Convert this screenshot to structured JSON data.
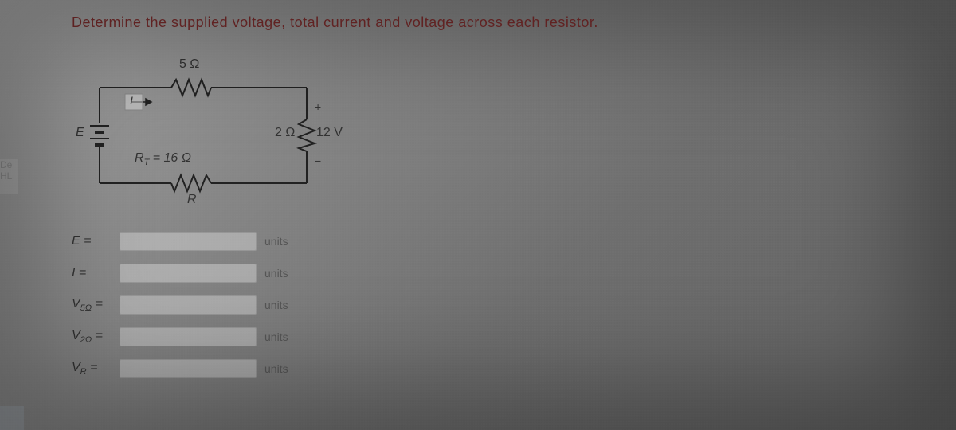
{
  "prompt": "Determine the supplied voltage, total current and voltage across each resistor.",
  "circuit": {
    "source_label": "E",
    "current_label": "I",
    "r1_label": "5 Ω",
    "r2_value": "2 Ω",
    "r2_volt": "12 V",
    "r2_plus": "+",
    "r2_minus": "−",
    "rt_label": "R_T = 16 Ω",
    "r_bottom_label": "R"
  },
  "answers": [
    {
      "label": "E =",
      "units": "units"
    },
    {
      "label": "I =",
      "units": "units"
    },
    {
      "label": "V5Ω =",
      "units": "units"
    },
    {
      "label": "V2Ω =",
      "units": "units"
    },
    {
      "label": "VR =",
      "units": "units"
    }
  ],
  "sidebar": {
    "de": "De",
    "hl": "HL"
  }
}
